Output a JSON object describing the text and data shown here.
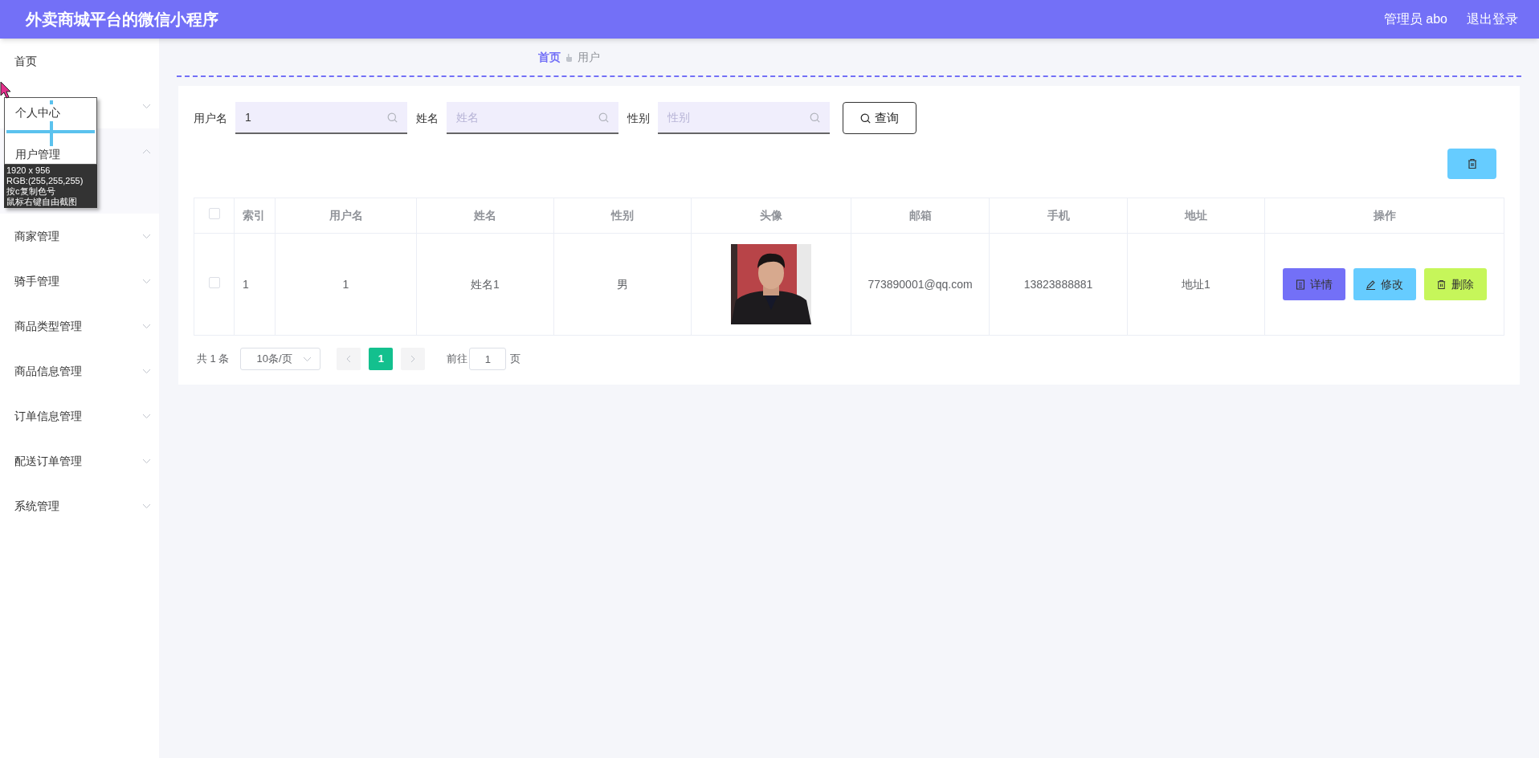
{
  "header": {
    "title": "外卖商城平台的微信小程序",
    "user_label": "管理员 abo",
    "logout": "退出登录"
  },
  "sidebar": {
    "items": [
      {
        "label": "首页",
        "has_children": false,
        "expanded": false
      },
      {
        "has_children": true,
        "expanded": false
      },
      {
        "has_children": true,
        "expanded": true
      },
      {
        "label": "商家管理",
        "has_children": true,
        "expanded": false
      },
      {
        "label": "骑手管理",
        "has_children": true,
        "expanded": false
      },
      {
        "label": "商品类型管理",
        "has_children": true,
        "expanded": false
      },
      {
        "label": "商品信息管理",
        "has_children": true,
        "expanded": false
      },
      {
        "label": "订单信息管理",
        "has_children": true,
        "expanded": false
      },
      {
        "label": "配送订单管理",
        "has_children": true,
        "expanded": false
      },
      {
        "label": "系统管理",
        "has_children": true,
        "expanded": false
      }
    ]
  },
  "breadcrumb": [
    {
      "label": "首页",
      "selected": true
    },
    {
      "label": "用户",
      "selected": false
    }
  ],
  "search": {
    "fields": [
      {
        "label": "用户名",
        "value": "1"
      },
      {
        "label": "姓名",
        "placeholder": "姓名"
      },
      {
        "label": "性别",
        "placeholder": "性别"
      }
    ],
    "button": "查询"
  },
  "table": {
    "select_all_checked": false,
    "columns": [
      "索引",
      "用户名",
      "姓名",
      "性别",
      "头像",
      "邮箱",
      "手机",
      "地址",
      "操作"
    ],
    "rows": [
      {
        "checked": false,
        "index": "1",
        "username": "1",
        "name": "姓名1",
        "gender": "男",
        "avatar": {
          "kind": "picture"
        },
        "email": "773890001@qq.com",
        "phone": "13823888881",
        "address": "地址1",
        "actions": [
          {
            "kind": "detail",
            "label": "详情"
          },
          {
            "kind": "edit",
            "label": "修改"
          },
          {
            "kind": "delete",
            "label": "删除"
          }
        ]
      }
    ]
  },
  "pagination": {
    "total": "共 1 条",
    "page_size": "10条/页",
    "pages": [
      {
        "label": "1",
        "selected": true
      }
    ],
    "goto_label": "前往",
    "goto_value": "1",
    "goto_suffix": "页"
  },
  "capture_overlay": {
    "magnified_items": [
      "个人中心",
      "用户管理"
    ],
    "info_lines": [
      "1920 x 956",
      "RGB:(255,255,255)",
      "按c复制色号",
      "鼠标右键自由截图"
    ]
  }
}
